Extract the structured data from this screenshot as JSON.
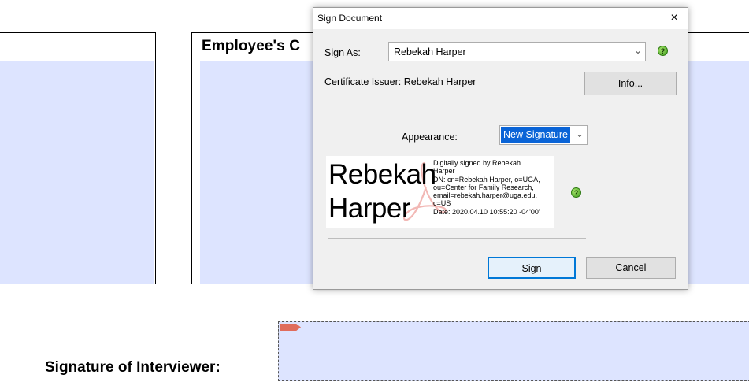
{
  "background": {
    "employee_box_title": "Employee's C",
    "signature_label": "Signature of Interviewer:"
  },
  "dialog": {
    "title": "Sign Document",
    "close_glyph": "×",
    "sign_as_label": "Sign As:",
    "sign_as_value": "Rebekah Harper",
    "certificate_issuer": "Certificate Issuer: Rebekah Harper",
    "info_button": "Info...",
    "appearance_label": "Appearance:",
    "appearance_value": "New Signature",
    "preview": {
      "name_line1": "Rebekah",
      "name_line2": "Harper",
      "details": [
        "Digitally signed by Rebekah",
        "Harper",
        "DN: cn=Rebekah Harper, o=UGA,",
        "ou=Center for Family Research,",
        "email=rebekah.harper@uga.edu,",
        "c=US",
        "Date: 2020.04.10 10:55:20 -04'00'"
      ]
    },
    "sign_button": "Sign",
    "cancel_button": "Cancel",
    "help_glyph": "?"
  },
  "colors": {
    "form_field": "#dde4ff",
    "selection": "#0a64d7",
    "default_button_border": "#0078d7"
  },
  "icons": [
    "help-icon",
    "close-icon",
    "chevron-down-icon",
    "acrobat-logo-icon",
    "field-flag-icon"
  ]
}
